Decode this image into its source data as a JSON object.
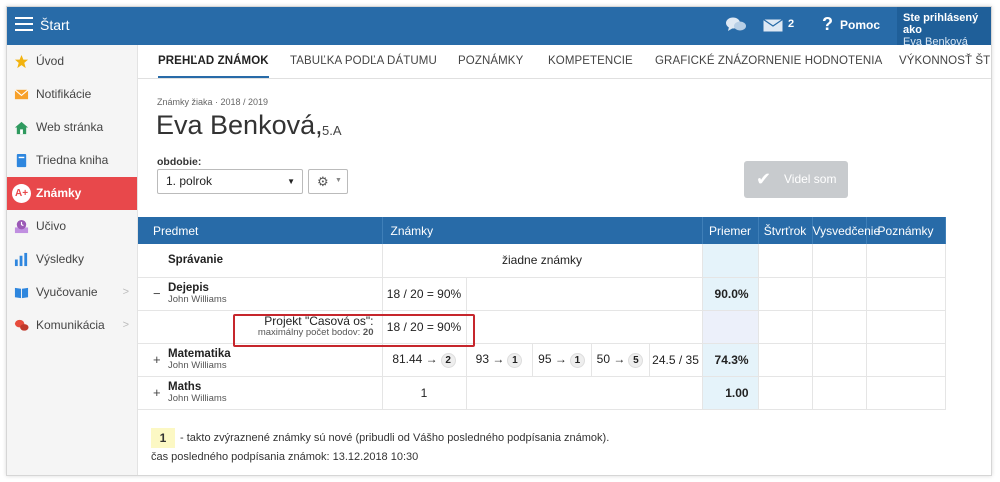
{
  "topbar": {
    "title": "Štart",
    "mail_count": "2",
    "help_label": "Pomoc",
    "user_line1": "Ste prihlásený ako",
    "user_line2": "Eva Benková"
  },
  "sidebar": {
    "items": [
      {
        "label": "Úvod",
        "icon": "star-icon"
      },
      {
        "label": "Notifikácie",
        "icon": "envelope-icon"
      },
      {
        "label": "Web stránka",
        "icon": "home-icon"
      },
      {
        "label": "Triedna kniha",
        "icon": "book-icon"
      },
      {
        "label": "Známky",
        "icon": "grade-icon",
        "icon_text": "A+"
      },
      {
        "label": "Učivo",
        "icon": "clock-icon"
      },
      {
        "label": "Výsledky",
        "icon": "bar-chart-icon"
      },
      {
        "label": "Vyučovanie",
        "icon": "open-book-icon"
      },
      {
        "label": "Komunikácia",
        "icon": "chat-icon"
      }
    ]
  },
  "tabs": [
    "PREHĽAD ZNÁMOK",
    "TABUĽKA PODĽA DÁTUMU",
    "POZNÁMKY",
    "KOMPETENCIE",
    "GRAFICKÉ ZNÁZORNENIE HODNOTENIA",
    "VÝKONNOSŤ ŠTU"
  ],
  "header": {
    "crumb": "Známky žiaka · 2018 / 2019",
    "student_name": "Eva Benková,",
    "student_class": "5.A",
    "period_label": "obdobie:",
    "period_value": "1. polrok",
    "seen_button": "Videl som"
  },
  "table": {
    "columns": [
      "Predmet",
      "Známky",
      "Priemer",
      "Štvrťrok",
      "Vysvedčenie",
      "Poznámky"
    ],
    "rows": {
      "spravanie": {
        "name": "Správanie",
        "empty": "žiadne známky"
      },
      "dejepis": {
        "toggle": "−",
        "name": "Dejepis",
        "teacher": "John Williams",
        "grade": "18 / 20 = 90%",
        "avg": "90.0%"
      },
      "projekt": {
        "title": "Projekt \"Časová os\":",
        "max_label": "maximálny počet bodov:",
        "max_value": "20",
        "grade": "18 / 20 = 90%"
      },
      "matematika": {
        "toggle": "+",
        "name": "Matematika",
        "teacher": "John Williams",
        "grades": [
          {
            "score": "81.44 →",
            "mark": "2"
          },
          {
            "score": "93 →",
            "mark": "1"
          },
          {
            "score": "95 →",
            "mark": "1"
          },
          {
            "score": "50 →",
            "mark": "5"
          }
        ],
        "points": "24.5 / 35",
        "avg": "74.3%"
      },
      "maths": {
        "toggle": "+",
        "name": "Maths",
        "teacher": "John Williams",
        "grade": "1",
        "avg": "1.00"
      }
    }
  },
  "legend": {
    "badge": "1",
    "text": "- takto zvýraznené známky sú nové (pribudli od Vášho posledného podpísania známok).",
    "last_sign": "čas posledného podpísania známok: 13.12.2018 10:30"
  },
  "colors": {
    "primary": "#286ba8",
    "active": "#e8484b",
    "highlight": "#c6262c"
  }
}
